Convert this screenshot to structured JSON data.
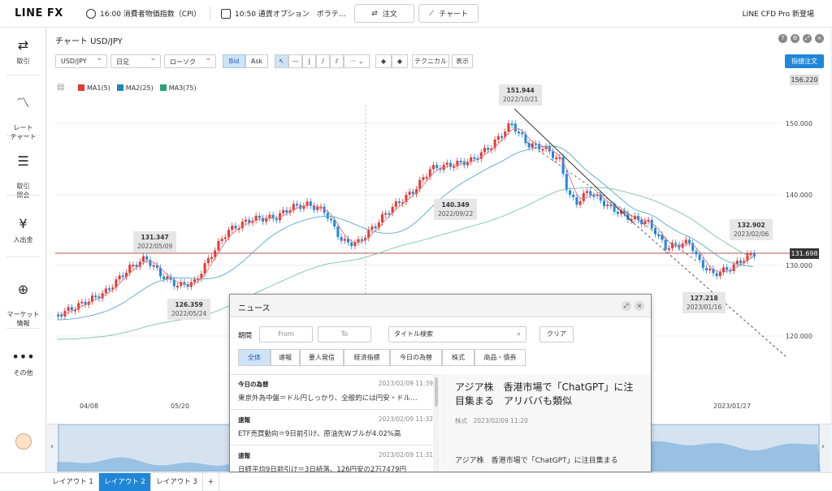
{
  "topbar": {
    "logo": "LINE FX",
    "ticker1": "16:00 消費者物価指数（CPI）",
    "ticker2": "10:50 通貨オプション　ボラテ…",
    "order_label": "注文",
    "chart_label": "チャート",
    "promo": "LINE CFD Pro 新登場"
  },
  "sidebar": {
    "items": [
      {
        "label": "取引",
        "icon": "arrows-icon"
      },
      {
        "label": "レート\nチャート",
        "icon": "line-chart-icon"
      },
      {
        "label": "取引\n照会",
        "icon": "list-icon"
      },
      {
        "label": "入出金",
        "icon": "yen-icon"
      },
      {
        "label": "マーケット\n情報",
        "icon": "globe-icon"
      },
      {
        "label": "その他",
        "icon": "more-icon"
      }
    ]
  },
  "chart": {
    "title": "チャート USD/JPY",
    "toolbar": {
      "symbol": "USD/JPY",
      "period": "日足",
      "style": "ローソク",
      "bid": "Bid",
      "ask": "Ask",
      "technical": "テクニカル",
      "display": "表示",
      "limit_order": "指値注文"
    },
    "legend": [
      {
        "label": "MA1(5)",
        "color": "#e53935"
      },
      {
        "label": "MA2(25)",
        "color": "#1e88b4"
      },
      {
        "label": "MA3(75)",
        "color": "#26a17a"
      }
    ],
    "y_labels": [
      "150.000",
      "140.000",
      "130.000",
      "120.000"
    ],
    "top_price": "156.220",
    "current_price": "131.698",
    "x_labels": [
      "04/08",
      "05/20",
      "2023/01/27"
    ],
    "callouts": [
      {
        "price": "151.944",
        "date": "2022/10/21"
      },
      {
        "price": "140.349",
        "date": "2022/09/22"
      },
      {
        "price": "131.347",
        "date": "2022/05/09"
      },
      {
        "price": "126.359",
        "date": "2022/05/24"
      },
      {
        "price": "132.902",
        "date": "2023/02/06"
      },
      {
        "price": "127.218",
        "date": "2023/01/16"
      }
    ]
  },
  "news": {
    "title": "ニュース",
    "period_label": "期間",
    "from_placeholder": "From",
    "to_placeholder": "To",
    "search_placeholder": "タイトル検索",
    "clear_label": "クリア",
    "tabs": [
      "全体",
      "速報",
      "要人発信",
      "経済指標",
      "今日の為替",
      "株式",
      "商品・債券"
    ],
    "items": [
      {
        "category": "今日の為替",
        "date": "2023/02/09 11:39",
        "headline": "東京外為中盤＝ドル円しっかり、全般的には円安・ドル…"
      },
      {
        "category": "速報",
        "date": "2023/02/09 11:32",
        "headline": "ETF売買動向＝9日前引け、原油先Wブルが4.02%高"
      },
      {
        "category": "速報",
        "date": "2023/02/09 11:31",
        "headline": "日経平均9日前引け＝3日続落、126円安の2万7479円"
      }
    ],
    "detail": {
      "title": "アジア株　香港市場で「ChatGPT」に注目集まる　アリババも類似",
      "meta": "株式　2023/02/09 11:20",
      "body": "アジア株　香港市場で「ChatGPT」に注目集まる"
    }
  },
  "layout_tabs": [
    "レイアウト 1",
    "レイアウト 2",
    "レイアウト 3",
    "+"
  ]
}
